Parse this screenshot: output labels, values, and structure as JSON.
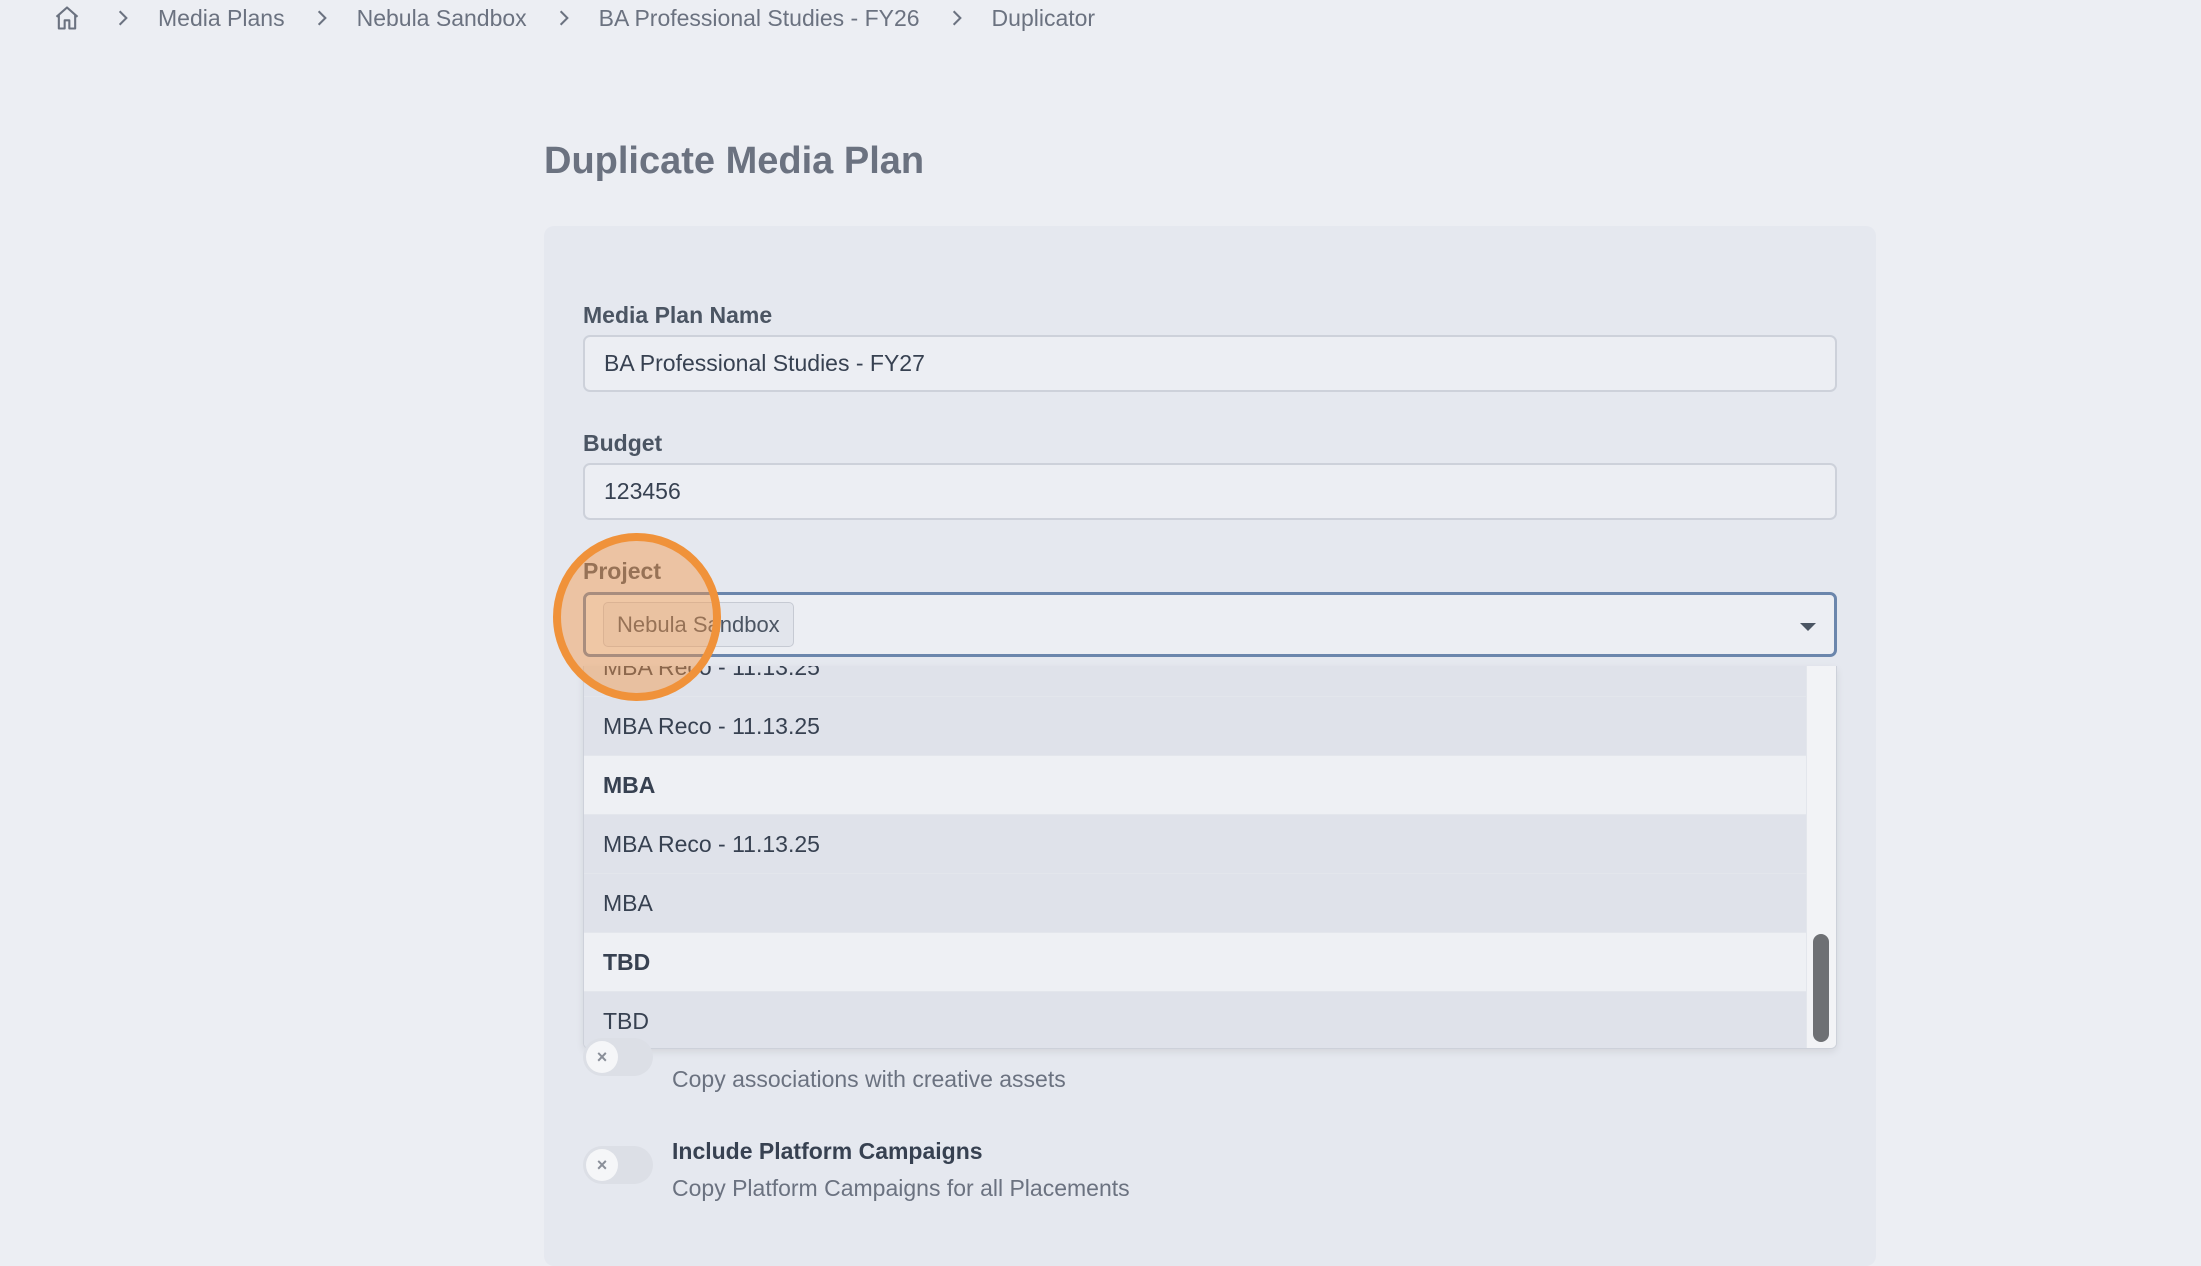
{
  "breadcrumb": {
    "items": [
      "Media Plans",
      "Nebula Sandbox",
      "BA Professional Studies - FY26",
      "Duplicator"
    ]
  },
  "page": {
    "title": "Duplicate Media Plan"
  },
  "form": {
    "name_label": "Media Plan Name",
    "name_value": "BA Professional Studies - FY27",
    "budget_label": "Budget",
    "budget_value": "123456",
    "project_label": "Project",
    "project_selected": "Nebula Sandbox"
  },
  "dropdown": {
    "partial_item": "MBA Reco - 11.13.25",
    "items": [
      {
        "label": "MBA Reco - 11.13.25",
        "kind": "option"
      },
      {
        "label": "MBA",
        "kind": "group"
      },
      {
        "label": "MBA Reco - 11.13.25",
        "kind": "option"
      },
      {
        "label": "MBA",
        "kind": "option"
      },
      {
        "label": "TBD",
        "kind": "group"
      },
      {
        "label": "TBD",
        "kind": "option"
      }
    ]
  },
  "options": {
    "creative": {
      "description": "Copy associations with creative assets",
      "enabled": false
    },
    "platform": {
      "title": "Include Platform Campaigns",
      "description": "Copy Platform Campaigns for all Placements",
      "enabled": false
    }
  },
  "icons": {
    "home": "home-icon",
    "separator": "chevron-right-icon",
    "caret": "caret-down-icon",
    "toggle_off": "x-icon"
  },
  "colors": {
    "highlight": "#f0923a",
    "focus_border": "#6b86ac",
    "background": "#eceef3"
  }
}
